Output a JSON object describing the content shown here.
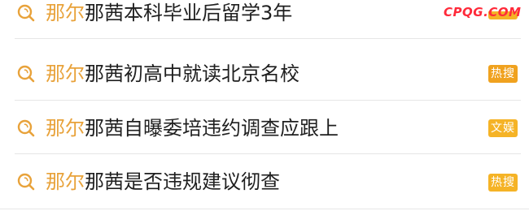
{
  "watermark": "CPQG.COM",
  "keyword": "那尔",
  "colors": {
    "keyword": "#e8a23a",
    "badge_orange": "#f0a21f",
    "badge_yellow": "#f5b326",
    "icon": "#e8a23a"
  },
  "results": [
    {
      "icon": "search-icon",
      "keyword": "那尔",
      "text": "那茜本科毕业后留学3年",
      "badge": "",
      "badge_color": "#f5b326"
    },
    {
      "icon": "search-icon",
      "keyword": "那尔",
      "text": "那茜初高中就读北京名校",
      "badge": "热搜",
      "badge_color": "#f0a21f"
    },
    {
      "icon": "search-icon",
      "keyword": "那尔",
      "text": "那茜自曝委培违约调查应跟上",
      "badge": "文娱",
      "badge_color": "#f5b326"
    },
    {
      "icon": "search-icon",
      "keyword": "那尔",
      "text": "那茜是否违规建议彻查",
      "badge": "热搜",
      "badge_color": "#f5b326"
    }
  ]
}
